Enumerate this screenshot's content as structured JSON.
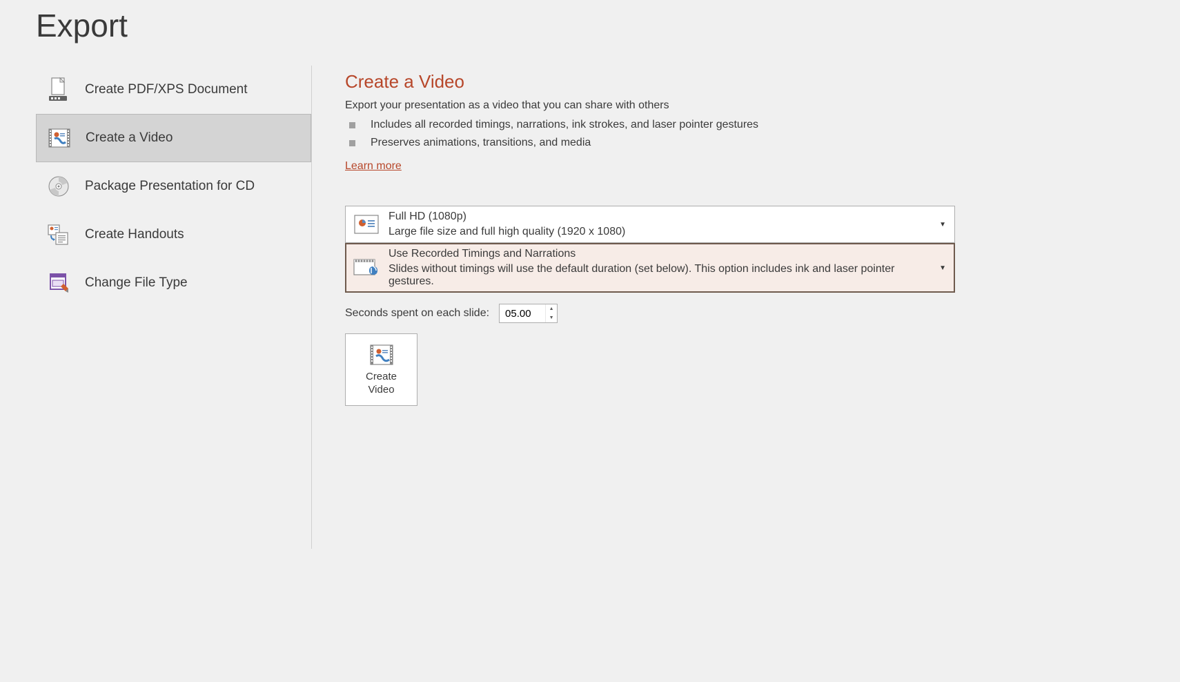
{
  "page": {
    "title": "Export"
  },
  "sidebar": {
    "items": [
      {
        "label": "Create PDF/XPS Document"
      },
      {
        "label": "Create a Video"
      },
      {
        "label": "Package Presentation for CD"
      },
      {
        "label": "Create Handouts"
      },
      {
        "label": "Change File Type"
      }
    ]
  },
  "main": {
    "heading": "Create a Video",
    "subtitle": "Export your presentation as a video that you can share with others",
    "bullets": [
      "Includes all recorded timings, narrations, ink strokes, and laser pointer gestures",
      "Preserves animations, transitions, and media"
    ],
    "learn_more": "Learn more",
    "quality": {
      "title": "Full HD (1080p)",
      "sub": "Large file size and full high quality (1920 x 1080)"
    },
    "timings": {
      "title": "Use Recorded Timings and Narrations",
      "sub": "Slides without timings will use the default duration (set below). This option includes ink and laser pointer gestures."
    },
    "seconds_label": "Seconds spent on each slide:",
    "seconds_value": "05.00",
    "create_button": "Create\nVideo"
  }
}
